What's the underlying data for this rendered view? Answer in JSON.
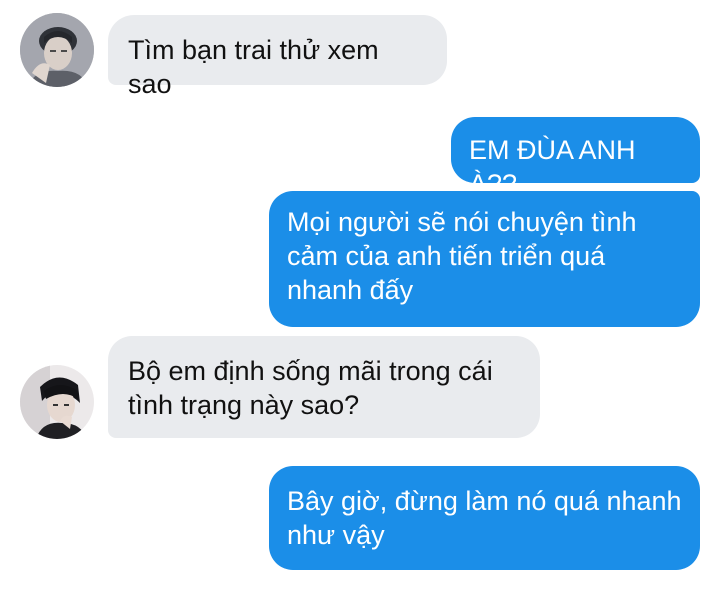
{
  "colors": {
    "outgoing_bubble": "#1b8ee8",
    "incoming_bubble": "#e9ebee",
    "outgoing_text": "#ffffff",
    "incoming_text": "#111111",
    "background": "#ffffff"
  },
  "messages": [
    {
      "sender": "other",
      "text": "Tìm bạn trai thử xem sao"
    },
    {
      "sender": "me",
      "text": "EM ĐÙA ANH À??"
    },
    {
      "sender": "me",
      "text": "Mọi người sẽ nói chuyện tình\ncảm của anh tiến triển quá\nnhanh đấy"
    },
    {
      "sender": "other",
      "text": "Bộ em định sống mãi trong cái\ntình trạng này sao?"
    },
    {
      "sender": "me",
      "text": "Bây giờ, đừng làm nó quá nhanh\nnhư vậy"
    }
  ],
  "avatars": [
    {
      "icon": "contact-avatar-photo"
    },
    {
      "icon": "contact-avatar-photo"
    }
  ]
}
